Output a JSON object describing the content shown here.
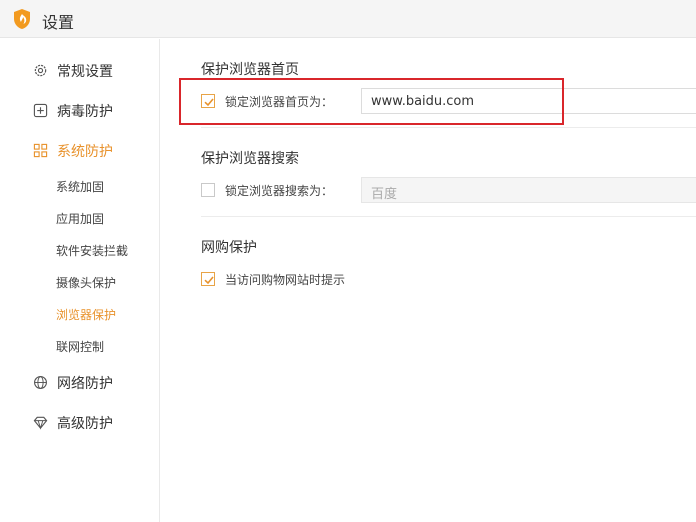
{
  "window": {
    "title": "设置"
  },
  "sidebar": {
    "items": [
      {
        "label": "常规设置",
        "icon": "gear-icon"
      },
      {
        "label": "病毒防护",
        "icon": "plus-box-icon"
      },
      {
        "label": "系统防护",
        "icon": "grid-icon",
        "active": true
      },
      {
        "label": "网络防护",
        "icon": "globe-icon"
      },
      {
        "label": "高级防护",
        "icon": "diamond-icon"
      }
    ],
    "sub_items": [
      {
        "label": "系统加固"
      },
      {
        "label": "应用加固"
      },
      {
        "label": "软件安装拦截"
      },
      {
        "label": "摄像头保护"
      },
      {
        "label": "浏览器保护",
        "active": true
      },
      {
        "label": "联网控制"
      }
    ]
  },
  "main": {
    "homepage": {
      "title": "保护浏览器首页",
      "checkbox_label": "锁定浏览器首页为：",
      "checked": true,
      "value": "www.baidu.com"
    },
    "search": {
      "title": "保护浏览器搜索",
      "checkbox_label": "锁定浏览器搜索为：",
      "checked": false,
      "value": "百度"
    },
    "shopping": {
      "title": "网购保护",
      "checkbox_label": "当访问购物网站时提示",
      "checked": true
    }
  },
  "colors": {
    "accent": "#e8922c",
    "highlight": "#d9262b"
  }
}
